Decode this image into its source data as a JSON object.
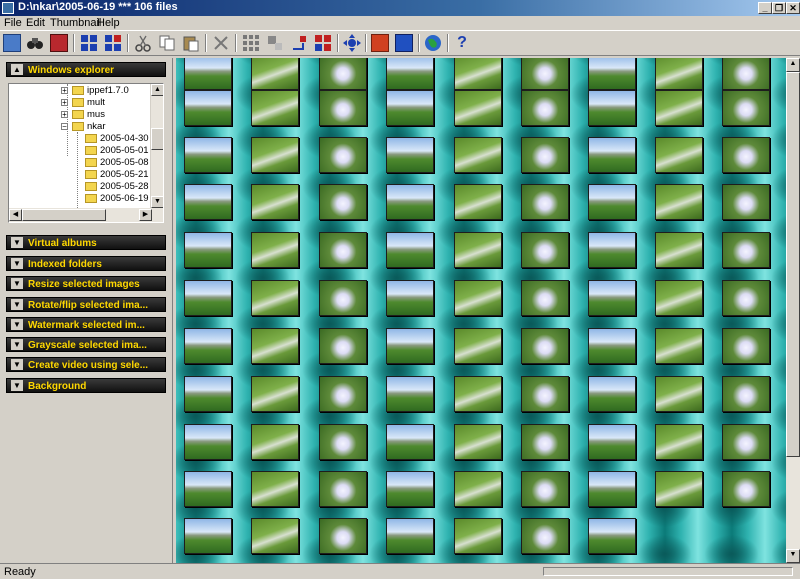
{
  "window": {
    "title": "D:\\nkar\\2005-06-19   ***   106 files",
    "buttons": [
      "_",
      "❐",
      "✕"
    ]
  },
  "menu": [
    {
      "label": "File",
      "key": "F"
    },
    {
      "label": "Edit",
      "key": "E"
    },
    {
      "label": "Thumbnail",
      "key": "T"
    },
    {
      "label": "Help",
      "key": "H"
    }
  ],
  "toolbar": {
    "icons": [
      "explorer-icon",
      "binoculars-icon",
      "camera-icon",
      "grid-large-icon",
      "grid-select-icon",
      "cut-icon",
      "copy-icon",
      "paste-icon",
      "delete-icon",
      "select-all-icon",
      "invert-select-icon",
      "arrange-icon",
      "flags-icon",
      "move-icon",
      "slideshow-icon",
      "display-icon",
      "globe-icon",
      "help-icon"
    ],
    "help_glyph": "?"
  },
  "sidebar": {
    "explorer_header": "Windows explorer",
    "tree": {
      "items": [
        {
          "label": "ippef1.7.0",
          "expander": "+"
        },
        {
          "label": "mult",
          "expander": "+"
        },
        {
          "label": "mus",
          "expander": "+"
        },
        {
          "label": "nkar",
          "expander": "−"
        },
        {
          "label": "2005-04-30"
        },
        {
          "label": "2005-05-01"
        },
        {
          "label": "2005-05-08"
        },
        {
          "label": "2005-05-21"
        },
        {
          "label": "2005-05-28"
        },
        {
          "label": "2005-06-19"
        }
      ]
    },
    "panels": [
      {
        "label": "Virtual albums"
      },
      {
        "label": "Indexed folders"
      },
      {
        "label": "Resize selected images"
      },
      {
        "label": "Rotate/flip selected ima..."
      },
      {
        "label": "Watermark selected im..."
      },
      {
        "label": "Grayscale selected ima..."
      },
      {
        "label": "Create video using sele..."
      },
      {
        "label": "Background"
      }
    ]
  },
  "status": {
    "text": "Ready"
  }
}
